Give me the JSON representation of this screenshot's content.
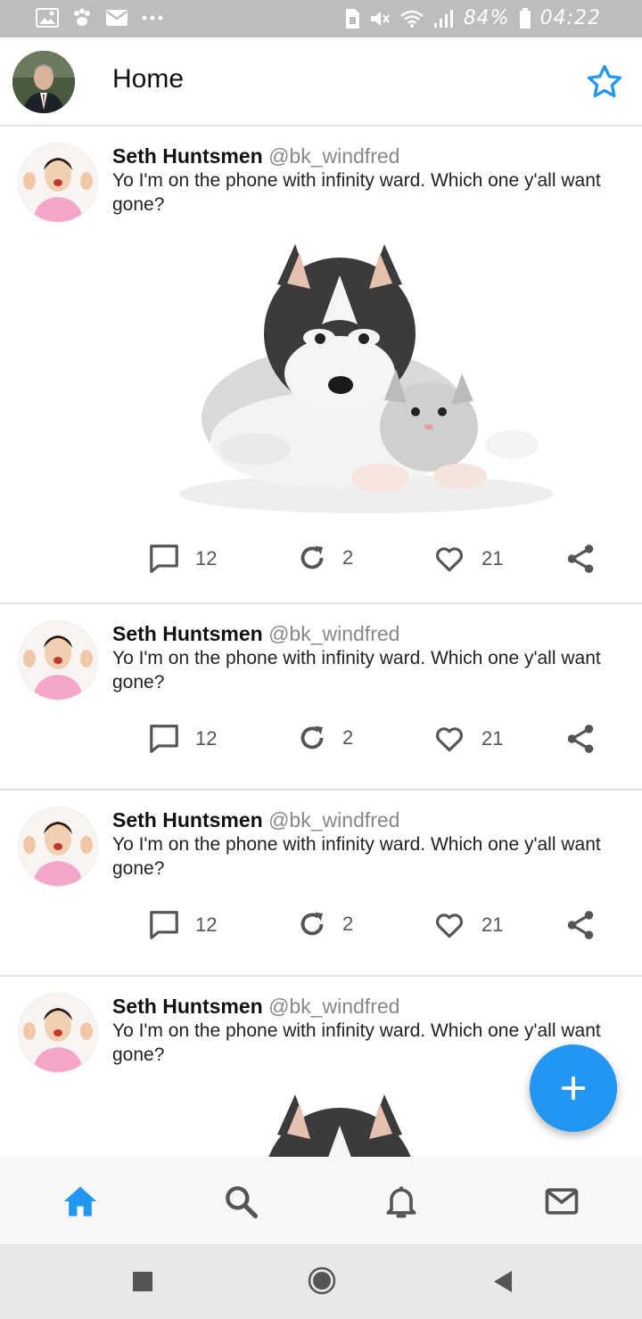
{
  "status_bar": {
    "left_icons": [
      "gallery-icon",
      "paw-icon",
      "mail-icon",
      "more-dots-icon"
    ],
    "right_icons": [
      "sim-icon",
      "mute-icon",
      "wifi-icon",
      "signal-icon",
      "battery-icon"
    ],
    "battery": "84%",
    "time": "04:22"
  },
  "app_bar": {
    "title": "Home",
    "action_icon": "star-outline-icon"
  },
  "tweets": [
    {
      "name": "Seth Huntsmen",
      "handle": "@bk_windfred",
      "text": "Yo I'm on the phone with infinity ward. Which one y'all want gone?",
      "has_image": true,
      "replies": "12",
      "retweets": "2",
      "likes": "21"
    },
    {
      "name": "Seth Huntsmen",
      "handle": "@bk_windfred",
      "text": "Yo I'm on the phone with infinity ward. Which one y'all want gone?",
      "has_image": false,
      "replies": "12",
      "retweets": "2",
      "likes": "21"
    },
    {
      "name": "Seth Huntsmen",
      "handle": "@bk_windfred",
      "text": "Yo I'm on the phone with infinity ward. Which one y'all want gone?",
      "has_image": false,
      "replies": "12",
      "retweets": "2",
      "likes": "21"
    },
    {
      "name": "Seth Huntsmen",
      "handle": "@bk_windfred",
      "text": "Yo I'm on the phone with infinity ward. Which one y'all want gone?",
      "has_image": true,
      "replies": "",
      "retweets": "",
      "likes": ""
    }
  ],
  "bottom_nav": {
    "items": [
      "home-icon",
      "search-icon",
      "bell-icon",
      "mail-icon"
    ],
    "active": "home"
  },
  "fab": {
    "icon": "plus-icon"
  },
  "colors": {
    "accent": "#2196f3",
    "status_bar": "#bdbdbd",
    "divider": "#e0e0e0",
    "text_primary": "#111111",
    "text_secondary": "#888888",
    "icon_gray": "#555555"
  }
}
